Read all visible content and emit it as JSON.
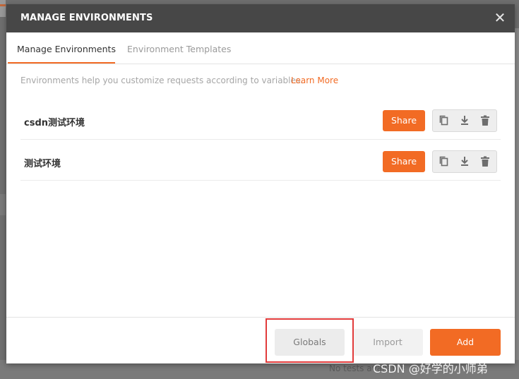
{
  "dialog": {
    "title": "MANAGE ENVIRONMENTS",
    "close_glyph": "✕"
  },
  "tabs": [
    {
      "label": "Manage Environments",
      "active": true
    },
    {
      "label": "Environment Templates",
      "active": false
    }
  ],
  "info": {
    "text": "Environments help you customize requests according to variables.",
    "link": "Learn More"
  },
  "environments": [
    {
      "name": "csdn测试环境",
      "share_label": "Share"
    },
    {
      "name": "测试环境",
      "share_label": "Share"
    }
  ],
  "footer": {
    "globals_label": "Globals",
    "import_label": "Import",
    "add_label": "Add"
  },
  "background": {
    "bottom_text": "No tests available"
  },
  "watermark": "CSDN @好学的小师弟",
  "colors": {
    "accent": "#f26b24",
    "header": "#474747",
    "highlight": "#e23b3b"
  },
  "icons": [
    "copy-icon",
    "download-icon",
    "trash-icon",
    "close-icon"
  ]
}
